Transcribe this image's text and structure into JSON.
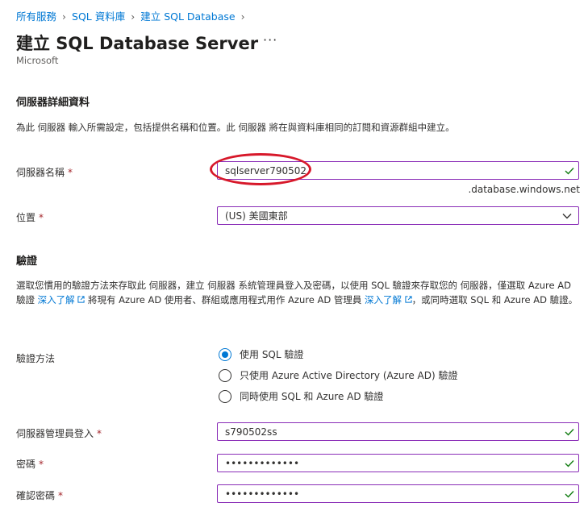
{
  "breadcrumb": {
    "items": [
      "所有服務",
      "SQL 資料庫",
      "建立 SQL Database"
    ]
  },
  "header": {
    "title": "建立 SQL Database Server",
    "more": "···",
    "subtitle": "Microsoft"
  },
  "server_details": {
    "heading": "伺服器詳細資料",
    "description": "為此 伺服器 輸入所需設定，包括提供名稱和位置。此 伺服器 將在與資料庫相同的訂閱和資源群組中建立。",
    "server_name": {
      "label": "伺服器名稱",
      "value": "sqlserver790502",
      "suffix": ".database.windows.net"
    },
    "location": {
      "label": "位置",
      "value": "(US) 美國東部"
    }
  },
  "auth": {
    "heading": "驗證",
    "description_part1": "選取您慣用的驗證方法來存取此 伺服器，建立 伺服器 系統管理員登入及密碼，以使用 SQL 驗證來存取您的 伺服器，僅選取 Azure AD 驗證 ",
    "link1": "深入了解",
    "description_part2": " 將現有 Azure AD 使用者、群組或應用程式用作 Azure AD 管理員 ",
    "link2": "深入了解",
    "description_part3": "，或同時選取 SQL 和 Azure AD 驗證。",
    "method_label": "驗證方法",
    "options": [
      "使用 SQL 驗證",
      "只使用 Azure Active Directory (Azure AD) 驗證",
      "同時使用 SQL 和 Azure AD 驗證"
    ],
    "selected_option": "使用 SQL 驗證",
    "admin_login": {
      "label": "伺服器管理員登入",
      "value": "s790502ss"
    },
    "password": {
      "label": "密碼",
      "value": "•••••••••••••"
    },
    "confirm_password": {
      "label": "確認密碼",
      "value": "•••••••••••••"
    }
  },
  "required_mark": "*",
  "colors": {
    "accent": "#0078d4",
    "field_border": "#8a2db7",
    "check": "#107c10",
    "annotation": "#d7182a"
  }
}
